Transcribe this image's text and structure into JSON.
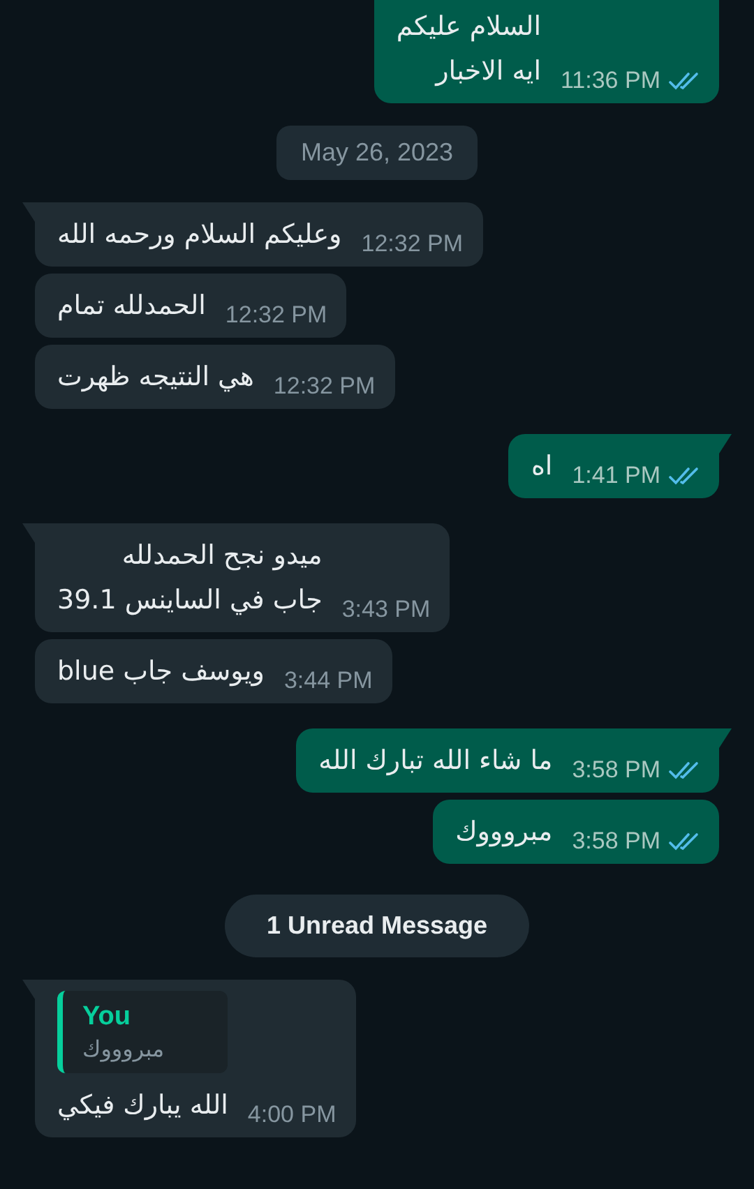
{
  "messages": [
    {
      "kind": "outgoing",
      "tail": false,
      "lines": [
        "السلام عليكم",
        "ايه الاخبار"
      ],
      "time": "11:36 PM",
      "read": true
    },
    {
      "kind": "date",
      "text": "May 26, 2023"
    },
    {
      "kind": "incoming",
      "tail": true,
      "lines": [
        "وعليكم السلام ورحمه الله"
      ],
      "time": "12:32 PM"
    },
    {
      "kind": "incoming",
      "tail": false,
      "lines": [
        "الحمدلله تمام"
      ],
      "time": "12:32 PM"
    },
    {
      "kind": "incoming",
      "tail": false,
      "lines": [
        "هي النتيجه ظهرت"
      ],
      "time": "12:32 PM"
    },
    {
      "kind": "outgoing",
      "tail": true,
      "lines": [
        "اه"
      ],
      "time": "1:41 PM",
      "read": true
    },
    {
      "kind": "incoming",
      "tail": true,
      "lines": [
        "ميدو نجح الحمدلله",
        "جاب في الساينس 39.1"
      ],
      "time": "3:43 PM"
    },
    {
      "kind": "incoming",
      "tail": false,
      "lines": [
        "ويوسف جاب blue"
      ],
      "time": "3:44 PM"
    },
    {
      "kind": "outgoing",
      "tail": true,
      "lines": [
        "ما شاء الله تبارك الله"
      ],
      "time": "3:58 PM",
      "read": true
    },
    {
      "kind": "outgoing",
      "tail": false,
      "lines": [
        "مبروووك"
      ],
      "time": "3:58 PM",
      "read": true
    },
    {
      "kind": "unread",
      "text": "1 Unread Message"
    },
    {
      "kind": "incoming",
      "tail": true,
      "quote": {
        "author": "You",
        "text": "مبروووك"
      },
      "lines": [
        "الله يبارك فيكي"
      ],
      "time": "4:00 PM"
    }
  ]
}
